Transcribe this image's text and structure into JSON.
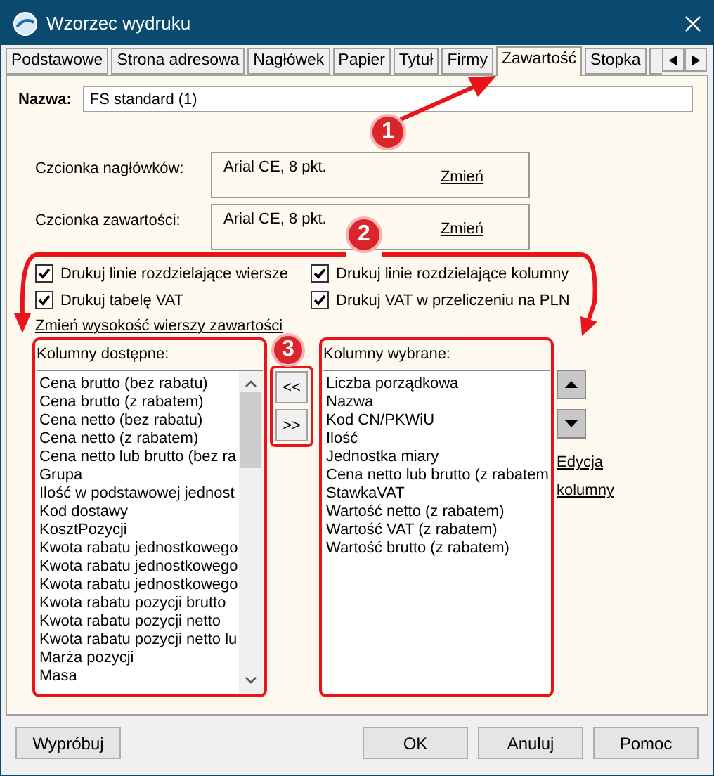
{
  "window": {
    "title": "Wzorzec wydruku"
  },
  "tabs": [
    {
      "label": "Podstawowe",
      "selected": false
    },
    {
      "label": "Strona adresowa",
      "selected": false
    },
    {
      "label": "Nagłówek",
      "selected": false
    },
    {
      "label": "Papier",
      "selected": false
    },
    {
      "label": "Tytuł",
      "selected": false
    },
    {
      "label": "Firmy",
      "selected": false
    },
    {
      "label": "Zawartość",
      "selected": true
    },
    {
      "label": "Stopka",
      "selected": false
    }
  ],
  "name_field": {
    "label": "Nazwa:",
    "value": "FS standard (1)"
  },
  "fonts": [
    {
      "label": "Czcionka nagłówków:",
      "value": "Arial CE, 8 pkt.",
      "link": "Zmień"
    },
    {
      "label": "Czcionka zawartości:",
      "value": "Arial CE, 8 pkt.",
      "link": "Zmień"
    }
  ],
  "checkboxes": [
    {
      "label": "Drukuj linie rozdzielające wiersze",
      "checked": true
    },
    {
      "label": "Drukuj linie rozdzielające kolumny",
      "checked": true
    },
    {
      "label": "Drukuj tabelę VAT",
      "checked": true
    },
    {
      "label": "Drukuj VAT w przeliczeniu na PLN",
      "checked": true
    }
  ],
  "row_height_link": "Zmień wysokość wierszy zawartości",
  "available_columns": {
    "label": "Kolumny dostępne:",
    "items": [
      "Cena brutto (bez rabatu)",
      "Cena brutto (z rabatem)",
      "Cena netto (bez rabatu)",
      "Cena netto (z rabatem)",
      "Cena netto lub brutto (bez ra",
      "Grupa",
      "Ilość w podstawowej jednost",
      "Kod dostawy",
      "KosztPozycji",
      "Kwota rabatu jednostkowego",
      "Kwota rabatu jednostkowego",
      "Kwota rabatu jednostkowego",
      "Kwota rabatu pozycji brutto",
      "Kwota rabatu pozycji netto",
      "Kwota rabatu pozycji netto lu",
      "Marża pozycji",
      "Masa"
    ]
  },
  "move_buttons": [
    "<<",
    ">>"
  ],
  "selected_columns": {
    "label": "Kolumny wybrane:",
    "items": [
      "Liczba porządkowa",
      "Nazwa",
      "Kod CN/PKWiU",
      "Ilość",
      "Jednostka miary",
      "Cena netto lub brutto (z rabatem",
      "StawkaVAT",
      "Wartość netto (z rabatem)",
      "Wartość VAT (z rabatem)",
      "Wartość brutto (z rabatem)"
    ]
  },
  "edit_columns_link": "Edycja kolumny",
  "footer": {
    "left_button": "Wypróbuj",
    "right_buttons": [
      "OK",
      "Anuluj",
      "Pomoc"
    ]
  },
  "annotations": [
    "1",
    "2",
    "3"
  ]
}
